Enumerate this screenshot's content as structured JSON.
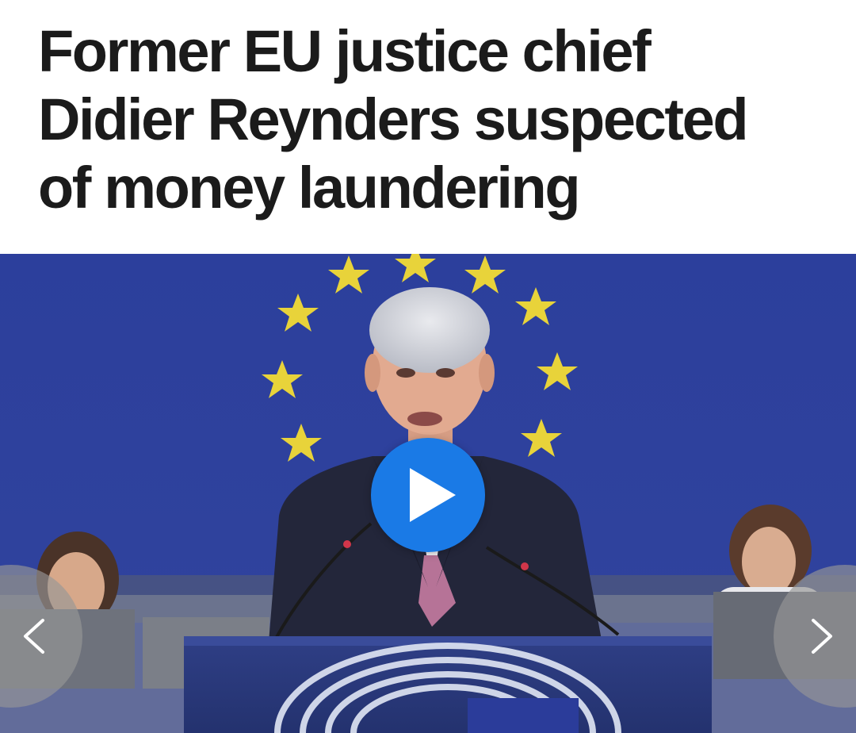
{
  "article": {
    "headline_lines": [
      "Former EU justice chief",
      "Didier Reynders suspected",
      "of money laundering"
    ]
  },
  "media": {
    "kind": "video",
    "play_icon": "play-icon",
    "prev_icon": "chevron-left-icon",
    "next_icon": "chevron-right-icon"
  },
  "colors": {
    "headline_text": "#1b1b1b",
    "eu_blue": "#2a3f9a",
    "eu_star_yellow": "#e8d33a",
    "play_button": "#1a7ae6",
    "nav_button": "#969696"
  }
}
